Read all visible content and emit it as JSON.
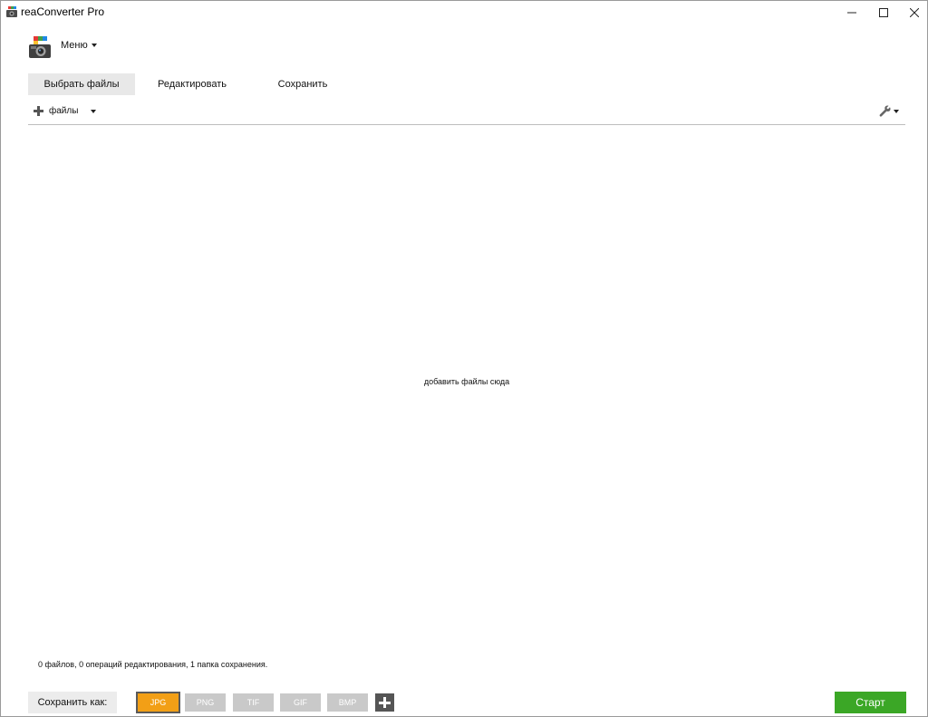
{
  "window": {
    "title": "reaConverter Pro",
    "controls": {
      "minimize": "—",
      "maximize": "☐",
      "close": "✕"
    }
  },
  "header": {
    "menu_label": "Меню"
  },
  "tabs": [
    {
      "label": "Выбрать файлы",
      "active": true
    },
    {
      "label": "Редактировать",
      "active": false
    },
    {
      "label": "Сохранить",
      "active": false
    }
  ],
  "toolbar": {
    "add_files_label": "файлы",
    "settings_icon": "wrench-icon"
  },
  "drop_area": {
    "hint": "добавить файлы сюда"
  },
  "status": {
    "text": "0 файлов, 0 операций редактирования, 1 папка сохранения."
  },
  "footer": {
    "save_as_label": "Сохранить как:",
    "formats": [
      {
        "label": "JPG",
        "active": true
      },
      {
        "label": "PNG",
        "active": false
      },
      {
        "label": "TIF",
        "active": false
      },
      {
        "label": "GIF",
        "active": false
      },
      {
        "label": "BMP",
        "active": false
      }
    ],
    "start_label": "Старт"
  },
  "colors": {
    "accent_format": "#f29f16",
    "start": "#3ba726",
    "inactive_format": "#c9c9c9"
  }
}
